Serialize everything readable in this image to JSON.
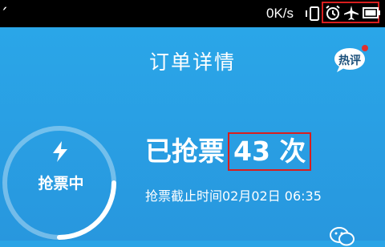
{
  "status_bar": {
    "left_glyph": "ˊ",
    "net_speed": "0K/s",
    "icons": [
      "vibrate-icon",
      "alarm-icon",
      "airplane-mode-icon",
      "battery-icon"
    ]
  },
  "header": {
    "title": "订单详情",
    "hot_review_label": "热评"
  },
  "status_ring": {
    "label": "抢票中",
    "icon": "lightning-icon"
  },
  "order": {
    "grab_prefix": "已抢票",
    "grab_count": "43 次",
    "deadline": "抢票截止时间02月02日 06:35"
  },
  "watermark": {
    "icon": "wechat-icon"
  },
  "colors": {
    "background": "#2aa4e6",
    "status_bar": "#000000",
    "highlight": "#d81e1e",
    "text": "#ffffff"
  }
}
